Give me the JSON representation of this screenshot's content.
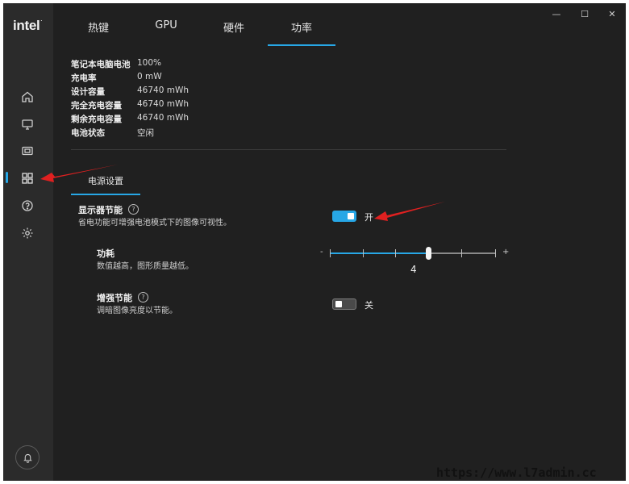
{
  "app": {
    "logo_text": "intel"
  },
  "window_controls": {
    "minimize": "—",
    "maximize": "☐",
    "close": "✕"
  },
  "tabs": [
    {
      "label": "热键",
      "active": false
    },
    {
      "label": "GPU",
      "active": false
    },
    {
      "label": "硬件",
      "active": false
    },
    {
      "label": "功率",
      "active": true
    }
  ],
  "battery_info": [
    {
      "label": "笔记本电脑电池",
      "value": "100%"
    },
    {
      "label": "充电率",
      "value": "0 mW"
    },
    {
      "label": "设计容量",
      "value": "46740 mWh"
    },
    {
      "label": "完全充电容量",
      "value": "46740 mWh"
    },
    {
      "label": "剩余充电容量",
      "value": "46740 mWh"
    },
    {
      "label": "电池状态",
      "value": "空闲"
    }
  ],
  "subtab": {
    "label": "电源设置"
  },
  "settings": {
    "display_power_saving": {
      "title": "显示器节能",
      "description": "省电功能可增强电池模式下的图像可视性。",
      "toggle_state": "on",
      "toggle_label": "开"
    },
    "power": {
      "title": "功耗",
      "description": "数值越高，图形质量越低。",
      "min_label": "-",
      "max_label": "+",
      "value": "4",
      "min": 1,
      "max": 7
    },
    "enhanced_power_saving": {
      "title": "增强节能",
      "description": "调暗图像亮度以节能。",
      "toggle_state": "off",
      "toggle_label": "关"
    }
  },
  "colors": {
    "accent": "#27a7e6",
    "background": "#202020",
    "sidebar": "#2b2b2b",
    "annotation_arrow": "#e02020"
  },
  "icons": [
    "home-icon",
    "monitor-icon",
    "video-icon",
    "apps-grid-icon",
    "help-circle-icon",
    "settings-gear-icon",
    "bell-icon"
  ],
  "watermark": "https://www.l7admin.cc"
}
